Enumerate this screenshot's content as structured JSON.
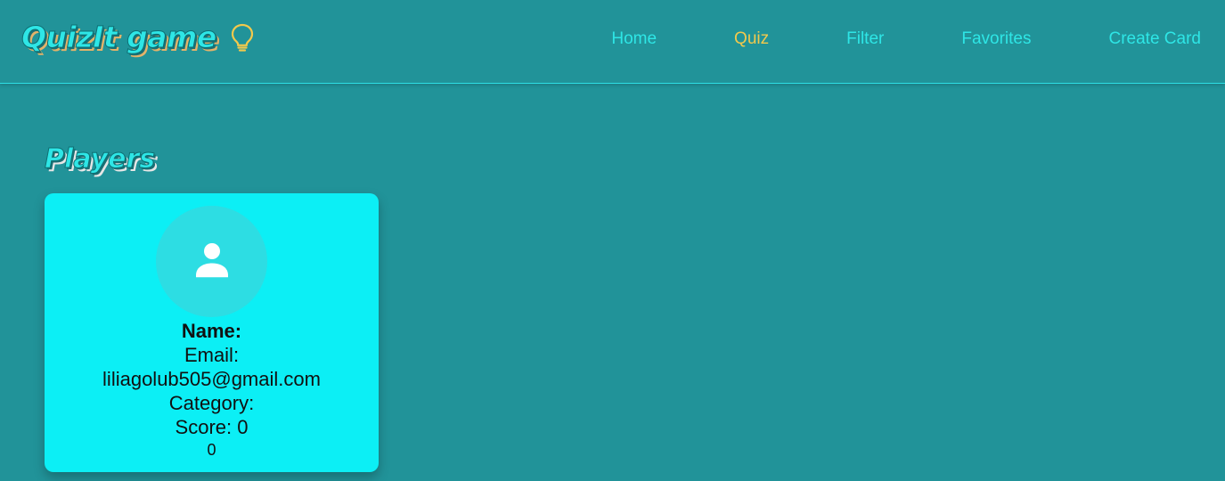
{
  "header": {
    "brand_title": "QuizIt game",
    "brand_icon": "lightbulb-icon",
    "nav": [
      {
        "label": "Home",
        "active": false
      },
      {
        "label": "Quiz",
        "active": true
      },
      {
        "label": "Filter",
        "active": false
      },
      {
        "label": "Favorites",
        "active": false
      },
      {
        "label": "Create Card",
        "active": false
      }
    ]
  },
  "main": {
    "section_title": "Players",
    "player": {
      "avatar_icon": "person-icon",
      "name_label": "Name:",
      "email_label": "Email:",
      "email_value": "liliagolub505@gmail.com",
      "category_label": "Category:",
      "score_label": "Score: 0",
      "score_extra": "0"
    }
  },
  "colors": {
    "background": "#219399",
    "accent": "#2ee6e6",
    "active_nav": "#f2c94c",
    "card": "#0ceff5",
    "avatar_bg": "#2ddde3"
  }
}
